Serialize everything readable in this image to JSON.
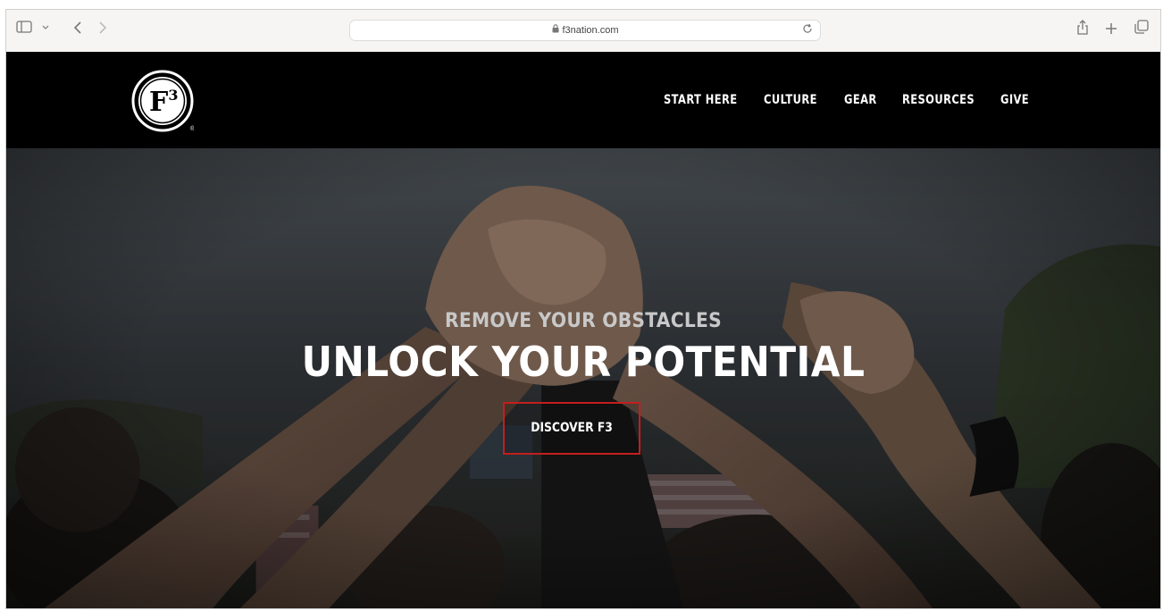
{
  "browser": {
    "url": "f3nation.com",
    "icons": [
      "sidebar-icon",
      "chevron-down-icon",
      "back-icon",
      "forward-icon",
      "lock-icon",
      "reload-icon",
      "share-icon",
      "plus-icon",
      "tabs-overview-icon"
    ]
  },
  "site": {
    "logo_text": "F3",
    "logo_sup": "3",
    "registered": "®",
    "nav": [
      {
        "label": "START HERE"
      },
      {
        "label": "CULTURE"
      },
      {
        "label": "GEAR"
      },
      {
        "label": "RESOURCES"
      },
      {
        "label": "GIVE"
      }
    ]
  },
  "hero": {
    "subtitle": "REMOVE YOUR OBSTACLES",
    "title": "UNLOCK YOUR POTENTIAL",
    "cta_label": "DISCOVER F3",
    "cta_border_color": "#c41e1e"
  },
  "colors": {
    "header_bg": "#000000",
    "toolbar_bg": "#f6f5f4"
  }
}
